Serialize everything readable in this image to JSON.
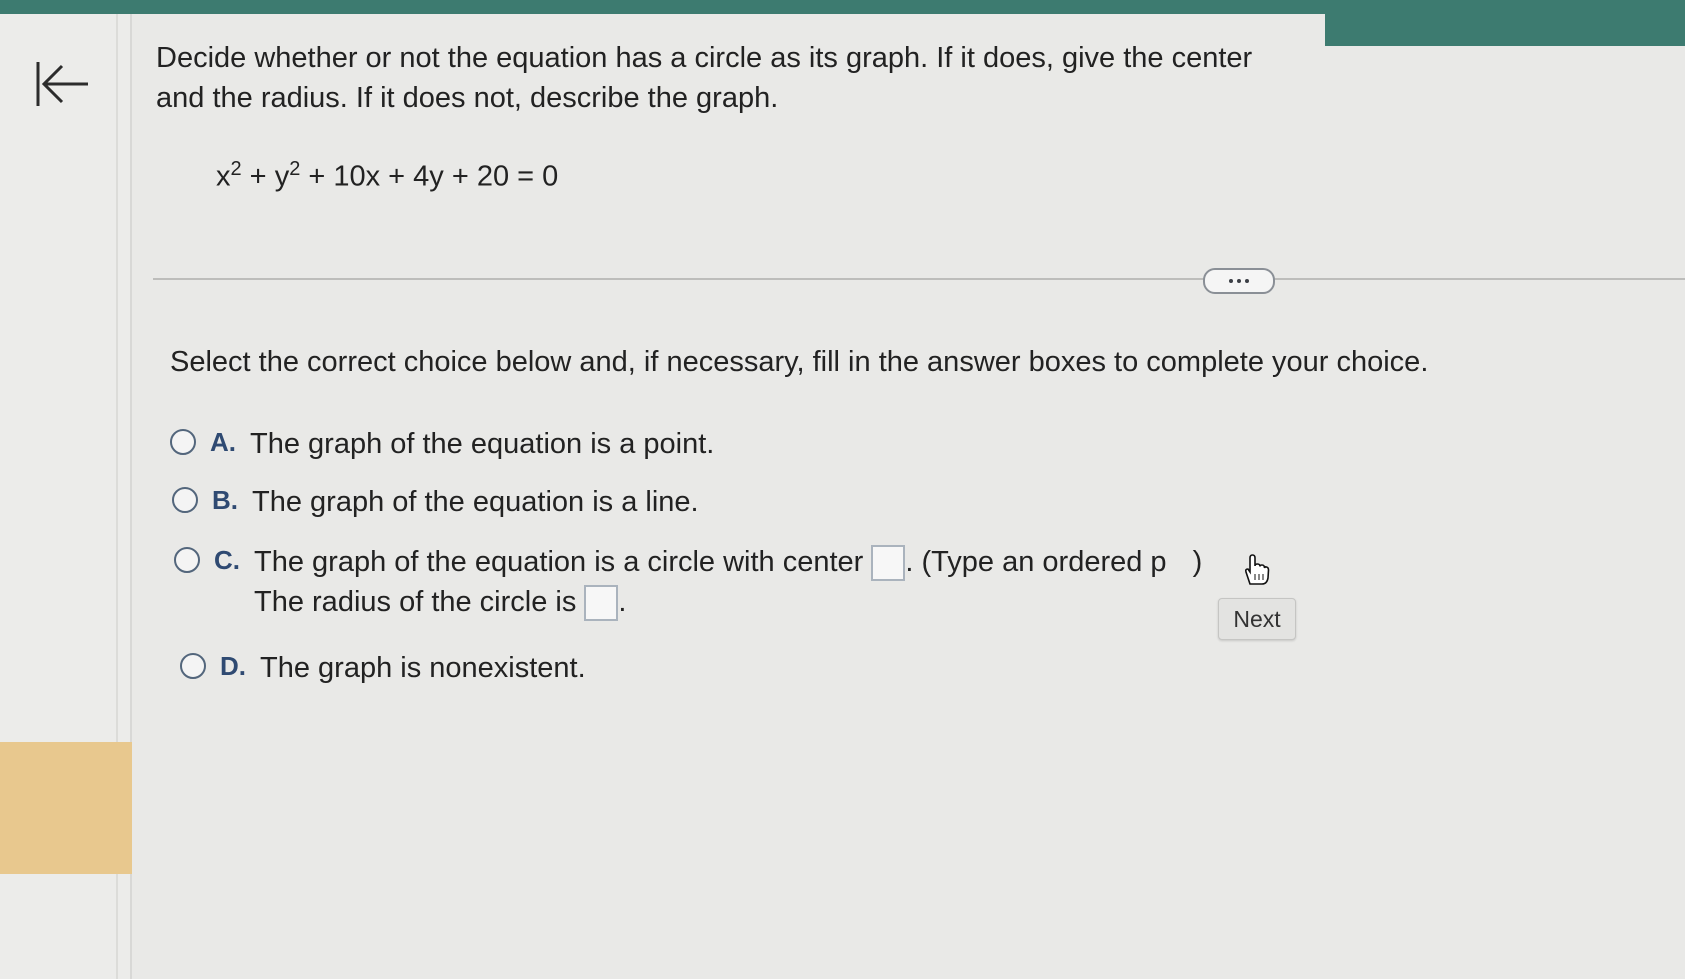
{
  "question": {
    "line1": "Decide whether or not the equation has a circle as its graph. If it does, give the center",
    "line2": "and the radius. If it does not, describe the graph.",
    "equation": {
      "x_base": "x",
      "x_exp": "2",
      "plus1": " + ",
      "y_base": "y",
      "y_exp": "2",
      "rest": " + 10x + 4y + 20 = 0"
    }
  },
  "instruction": "Select the correct choice below and, if necessary, fill in the answer boxes to complete your choice.",
  "choices": [
    {
      "letter": "A.",
      "text": "The graph of the equation is a point."
    },
    {
      "letter": "B.",
      "text": "The graph of the equation is a line."
    },
    {
      "letter": "C.",
      "text_before_center": "The graph of the equation is a circle with center",
      "text_after_center": ". (Type an ordered p",
      "text_end": ")",
      "radius_text": "The radius of the circle is",
      "radius_end": "."
    },
    {
      "letter": "D.",
      "text": "The graph is nonexistent."
    }
  ],
  "next_label": "Next",
  "colors": {
    "header": "#3d7b70",
    "highlight": "#e8c88e",
    "letter": "#2f4a72"
  }
}
